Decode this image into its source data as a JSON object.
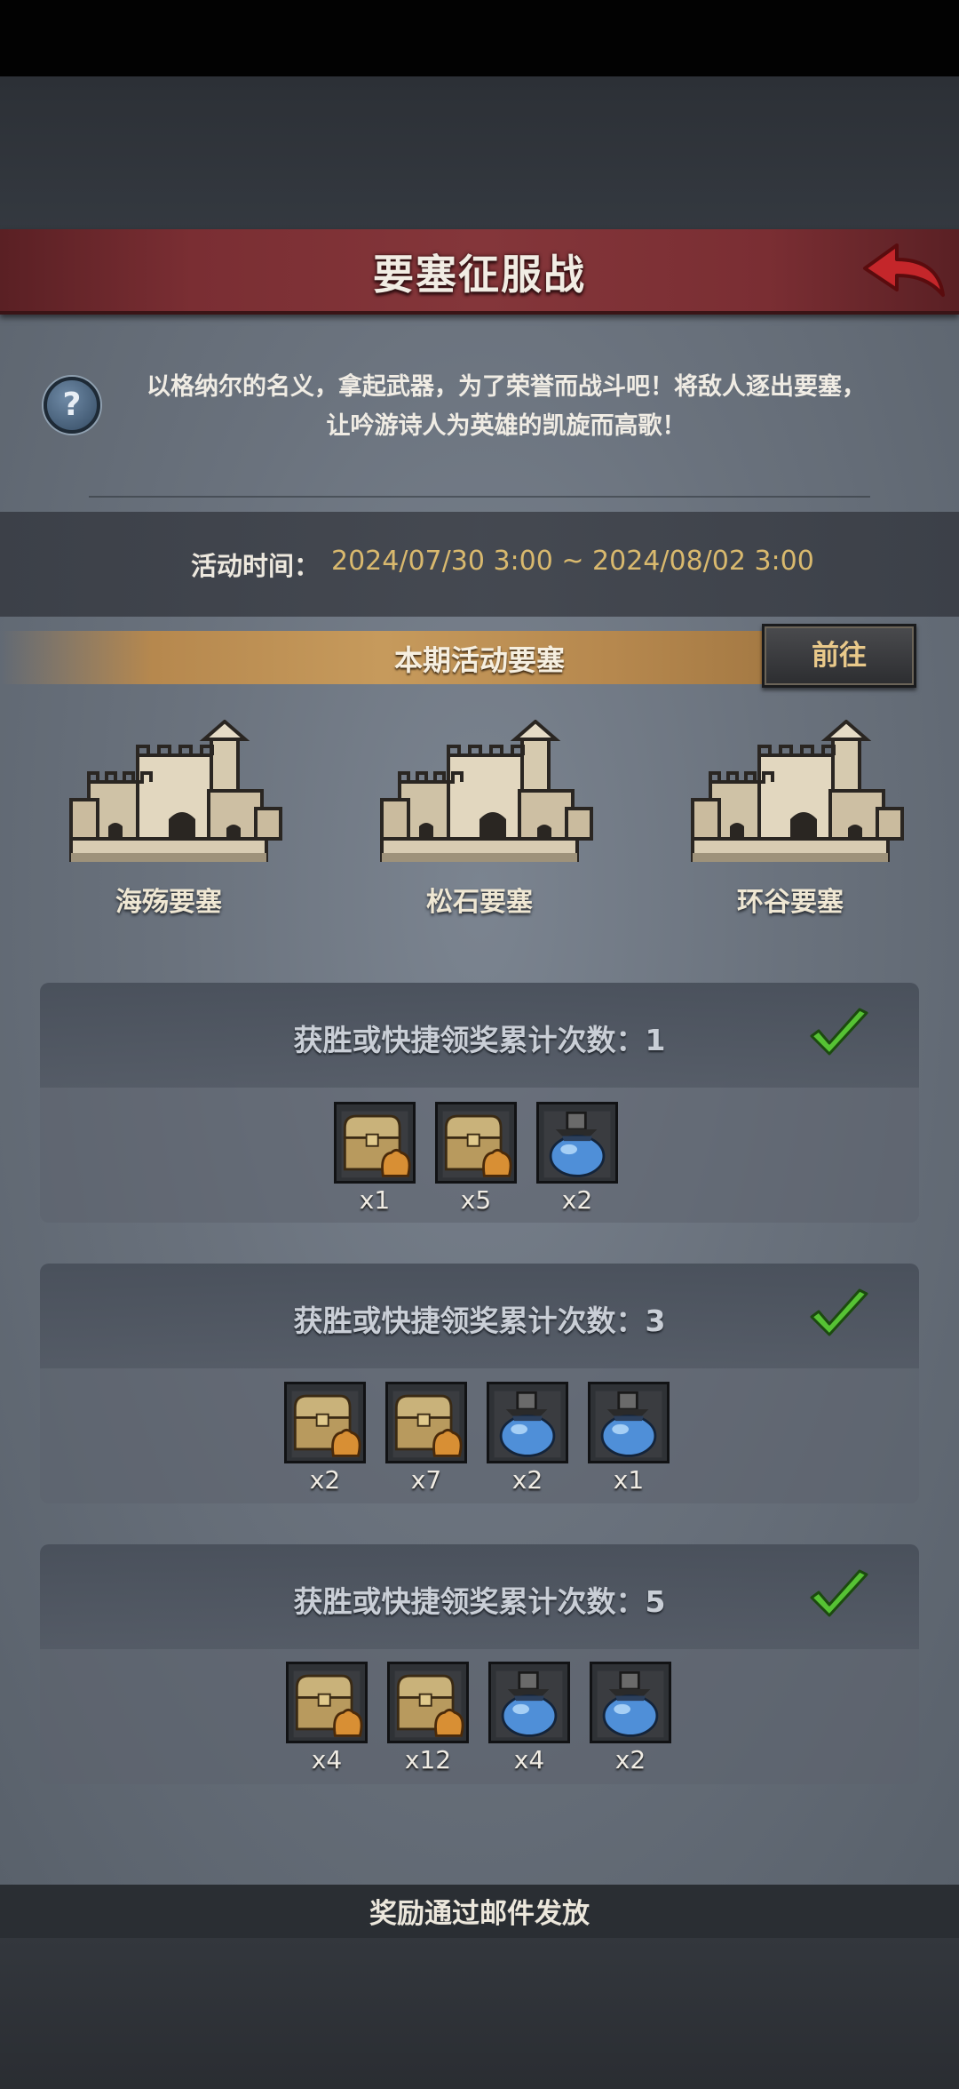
{
  "header": {
    "title": "要塞征服战",
    "back_icon": "back-arrow-icon"
  },
  "intro": {
    "line1": "以格纳尔的名义，拿起武器，为了荣誉而战斗吧！将敌人逐出要塞，",
    "line2": "让吟游诗人为英雄的凯旋而高歌！",
    "help_icon": "question-icon"
  },
  "event_time": {
    "label": "活动时间：",
    "value": "2024/07/30 3:00 ~ 2024/08/02 3:00"
  },
  "fortresses": {
    "header": "本期活动要塞",
    "goto_label": "前往",
    "items": [
      {
        "name": "海殇要塞"
      },
      {
        "name": "松石要塞"
      },
      {
        "name": "环谷要塞"
      }
    ]
  },
  "milestones": [
    {
      "title": "获胜或快捷领奖累计次数：1",
      "completed": true,
      "rewards": [
        {
          "icon": "treasure-chest-icon",
          "qty": "x1"
        },
        {
          "icon": "treasure-chest-icon",
          "qty": "x5"
        },
        {
          "icon": "blue-potion-icon",
          "qty": "x2"
        }
      ]
    },
    {
      "title": "获胜或快捷领奖累计次数：3",
      "completed": true,
      "rewards": [
        {
          "icon": "treasure-chest-icon",
          "qty": "x2"
        },
        {
          "icon": "treasure-chest-icon",
          "qty": "x7"
        },
        {
          "icon": "blue-potion-icon",
          "qty": "x2"
        },
        {
          "icon": "blue-potion-icon",
          "qty": "x1"
        }
      ]
    },
    {
      "title": "获胜或快捷领奖累计次数：5",
      "completed": true,
      "rewards": [
        {
          "icon": "treasure-chest-icon",
          "qty": "x4"
        },
        {
          "icon": "treasure-chest-icon",
          "qty": "x12"
        },
        {
          "icon": "blue-potion-icon",
          "qty": "x4"
        },
        {
          "icon": "blue-potion-icon",
          "qty": "x2"
        }
      ]
    }
  ],
  "footer": {
    "note": "奖励通过邮件发放"
  },
  "colors": {
    "accent_gold": "#d9b96e",
    "banner_red": "#84363a",
    "check_green": "#4fb830"
  }
}
